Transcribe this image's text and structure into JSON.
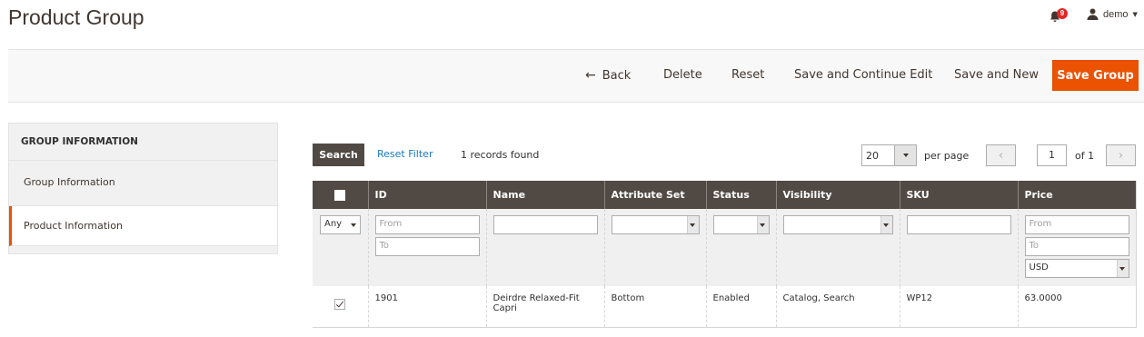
{
  "page": {
    "title": "Product Group"
  },
  "header": {
    "notifications_count": "9",
    "user_name": "demo"
  },
  "actions": {
    "back": "Back",
    "delete": "Delete",
    "reset": "Reset",
    "save_continue": "Save and Continue Edit",
    "save_new": "Save and New",
    "save_group": "Save Group"
  },
  "sidebar": {
    "title": "GROUP INFORMATION",
    "items": [
      {
        "label": "Group Information"
      },
      {
        "label": "Product Information"
      }
    ]
  },
  "grid": {
    "search_label": "Search",
    "reset_filter_label": "Reset Filter",
    "records_found": "1 records found",
    "per_page": "20",
    "per_page_label": "per page",
    "page": "1",
    "of_pages": "of 1",
    "columns": [
      "ID",
      "Name",
      "Attribute Set",
      "Status",
      "Visibility",
      "SKU",
      "Price"
    ],
    "filters": {
      "any": "Any",
      "id_from": "From",
      "id_to": "To",
      "price_from": "From",
      "price_to": "To",
      "currency": "USD"
    },
    "rows": [
      {
        "checked": true,
        "id": "1901",
        "name": "Deirdre Relaxed-Fit Capri",
        "attribute_set": "Bottom",
        "status": "Enabled",
        "visibility": "Catalog, Search",
        "sku": "WP12",
        "price": "63.0000"
      }
    ]
  },
  "colors": {
    "accent": "#eb5202",
    "header_bg": "#514943",
    "link": "#1979c3",
    "badge": "#e22626"
  }
}
